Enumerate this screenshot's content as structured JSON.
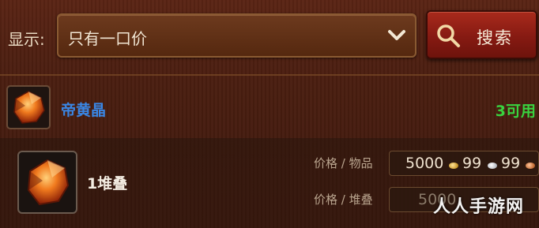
{
  "filter": {
    "label": "显示:",
    "selected": "只有一口价",
    "search_button": "搜索"
  },
  "item": {
    "name": "帝黄晶",
    "available": "3可用"
  },
  "listing": {
    "stack": "1堆叠",
    "price_per_item_label": "价格 / 物品",
    "price_per_stack_label": "价格 / 堆叠",
    "price_per_item": {
      "gold": "5000",
      "silver": "99",
      "copper": "99"
    },
    "price_per_stack": {
      "gold": "5000"
    }
  },
  "watermark": "人人手游网",
  "colors": {
    "item_name": "#3a86e4",
    "available": "#39d33f",
    "search_button": "#861a12"
  },
  "icons": [
    "chevron-down-icon",
    "search-icon",
    "gem-icon",
    "gold-coin-icon",
    "silver-coin-icon",
    "copper-coin-icon"
  ]
}
